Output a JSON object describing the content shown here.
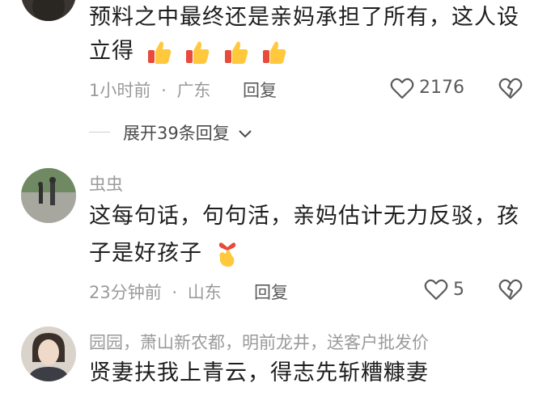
{
  "comments": [
    {
      "text_line1": "预料之中最终还是亲妈承担了所有，这人设",
      "text_line2": "立得",
      "emoji": "thumbs-up x4",
      "time": "1小时前",
      "separator": "·",
      "location": "广东",
      "reply_label": "回复",
      "likes": "2176"
    },
    {
      "username": "虫虫",
      "text_line1": "这每句话，句句活，亲妈估计无力反驳，孩",
      "text_line2": "子是好孩子",
      "emoji": "finger-heart",
      "time": "23分钟前",
      "separator": "·",
      "location": "山东",
      "reply_label": "回复",
      "likes": "5"
    },
    {
      "username": "园园，萧山新农都，明前龙井，送客户批发价",
      "text_line1": "贤妻扶我上青云，得志先斩糟糠妻"
    }
  ],
  "expand_replies": {
    "label": "展开39条回复"
  },
  "colors": {
    "text": "#1e1e1e",
    "meta": "#9a9a9a",
    "action": "#5a5a5a"
  },
  "icons": [
    "thumbs-up-icon",
    "heart-outline-icon",
    "broken-heart-icon",
    "chevron-down-icon",
    "finger-heart-icon"
  ]
}
